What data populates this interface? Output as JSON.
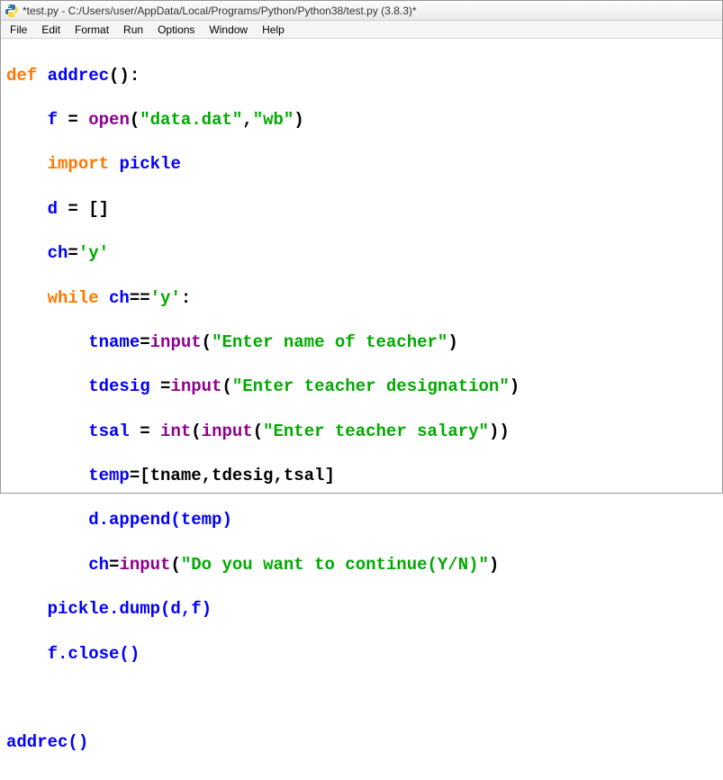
{
  "window": {
    "title": "*test.py - C:/Users/user/AppData/Local/Programs/Python/Python38/test.py (3.8.3)*"
  },
  "menu": {
    "items": [
      "File",
      "Edit",
      "Format",
      "Run",
      "Options",
      "Window",
      "Help"
    ]
  },
  "code": {
    "l1": {
      "kw": "def ",
      "nm": "addrec",
      "p": "():"
    },
    "l2": {
      "ind": "    ",
      "nm1": "f ",
      "op1": "= ",
      "bi": "open",
      "p1": "(",
      "s1": "\"data.dat\"",
      "c": ",",
      "s2": "\"wb\"",
      "p2": ")"
    },
    "l3": {
      "ind": "    ",
      "kw": "import ",
      "nm": "pickle"
    },
    "l4": {
      "ind": "    ",
      "nm": "d ",
      "op": "= []"
    },
    "l5": {
      "ind": "    ",
      "nm": "ch",
      "op": "=",
      "s": "'y'"
    },
    "l6": {
      "ind": "    ",
      "kw": "while ",
      "nm": "ch",
      "op": "==",
      "s": "'y'",
      "p": ":"
    },
    "l7": {
      "ind": "        ",
      "nm": "tname",
      "op": "=",
      "bi": "input",
      "p1": "(",
      "s": "\"Enter name of teacher\"",
      "p2": ")"
    },
    "l8": {
      "ind": "        ",
      "nm": "tdesig ",
      "op": "=",
      "bi": "input",
      "p1": "(",
      "s": "\"Enter teacher designation\"",
      "p2": ")"
    },
    "l9": {
      "ind": "        ",
      "nm": "tsal ",
      "op": "= ",
      "bi1": "int",
      "p1": "(",
      "bi2": "input",
      "p2": "(",
      "s": "\"Enter teacher salary\"",
      "p3": "))"
    },
    "l10": {
      "ind": "        ",
      "nm": "temp",
      "op": "=[tname,tdesig,tsal]"
    },
    "l11": {
      "ind": "        ",
      "nm": "d.append(temp)"
    },
    "l12": {
      "ind": "        ",
      "nm": "ch",
      "op": "=",
      "bi": "input",
      "p1": "(",
      "s": "\"Do you want to continue(Y/N)\"",
      "p2": ")"
    },
    "l13": {
      "ind": "    ",
      "nm": "pickle.dump(d,f)"
    },
    "l14": {
      "ind": "    ",
      "nm": "f.close()"
    },
    "l15": {
      "txt": ""
    },
    "l16": {
      "nm": "addrec()"
    }
  }
}
